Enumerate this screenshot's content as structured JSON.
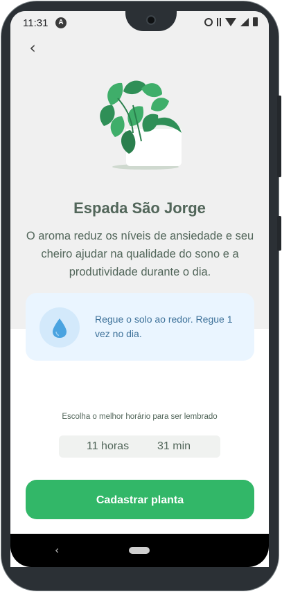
{
  "status_bar": {
    "time": "11:31",
    "badge_letter": "A"
  },
  "header": {
    "back_icon": "chevron-left-icon",
    "back_glyph": "‹"
  },
  "plant": {
    "name": "Espada São Jorge",
    "about": "O aroma reduz os níveis de ansiedade e seu cheiro ajudar na qualidade do sono e a produtividade durante o dia."
  },
  "tip": {
    "icon": "water-drop-icon",
    "text": "Regue o solo ao redor. Regue 1 vez no dia."
  },
  "reminder": {
    "label": "Escolha o melhor horário para ser lembrado",
    "hours": "11 horas",
    "minutes": "31 min"
  },
  "cta": {
    "label": "Cadastrar planta"
  },
  "navbar": {
    "back_glyph": "‹"
  },
  "colors": {
    "primary_green": "#32b768",
    "heading": "#52665a",
    "tip_bg": "#eaf5ff",
    "tip_text": "#3d7199",
    "screen_bg": "#f0f0f0"
  }
}
